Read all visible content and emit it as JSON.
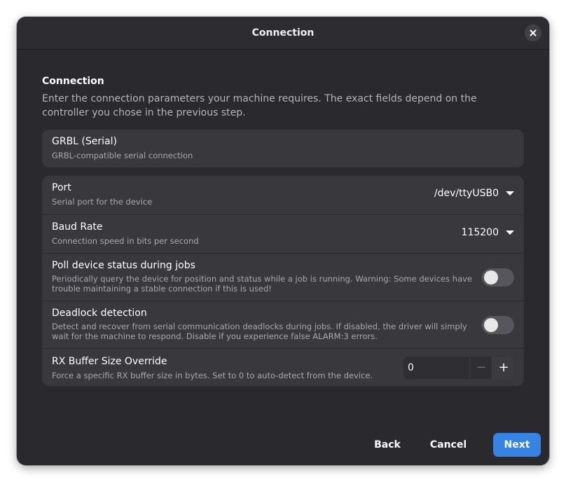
{
  "window": {
    "title": "Connection"
  },
  "section": {
    "title": "Connection",
    "description": "Enter the connection parameters your machine requires. The exact fields depend on the controller you chose in the previous step."
  },
  "driver_card": {
    "title": "GRBL (Serial)",
    "subtitle": "GRBL-compatible serial connection"
  },
  "settings": {
    "port": {
      "title": "Port",
      "subtitle": "Serial port for the device",
      "value": "/dev/ttyUSB0"
    },
    "baud_rate": {
      "title": "Baud Rate",
      "subtitle": "Connection speed in bits per second",
      "value": "115200"
    },
    "poll_status": {
      "title": "Poll device status during jobs",
      "subtitle": "Periodically query the device for position and status while a job is running. Warning: Some devices have trouble maintaining a stable connection if this is used!",
      "enabled": false
    },
    "deadlock": {
      "title": "Deadlock detection",
      "subtitle": "Detect and recover from serial communication deadlocks during jobs. If disabled, the driver will simply wait for the machine to respond. Disable if you experience false ALARM:3 errors.",
      "enabled": false
    },
    "rx_buffer": {
      "title": "RX Buffer Size Override",
      "subtitle": "Force a specific RX buffer size in bytes. Set to 0 to auto-detect from the device.",
      "value": "0",
      "minus": "−",
      "plus": "+"
    }
  },
  "footer": {
    "back_label": "Back",
    "cancel_label": "Cancel",
    "next_label": "Next"
  },
  "colors": {
    "accent": "#3584e4",
    "window_bg": "#2a2a2e",
    "card_bg": "#38383d"
  }
}
